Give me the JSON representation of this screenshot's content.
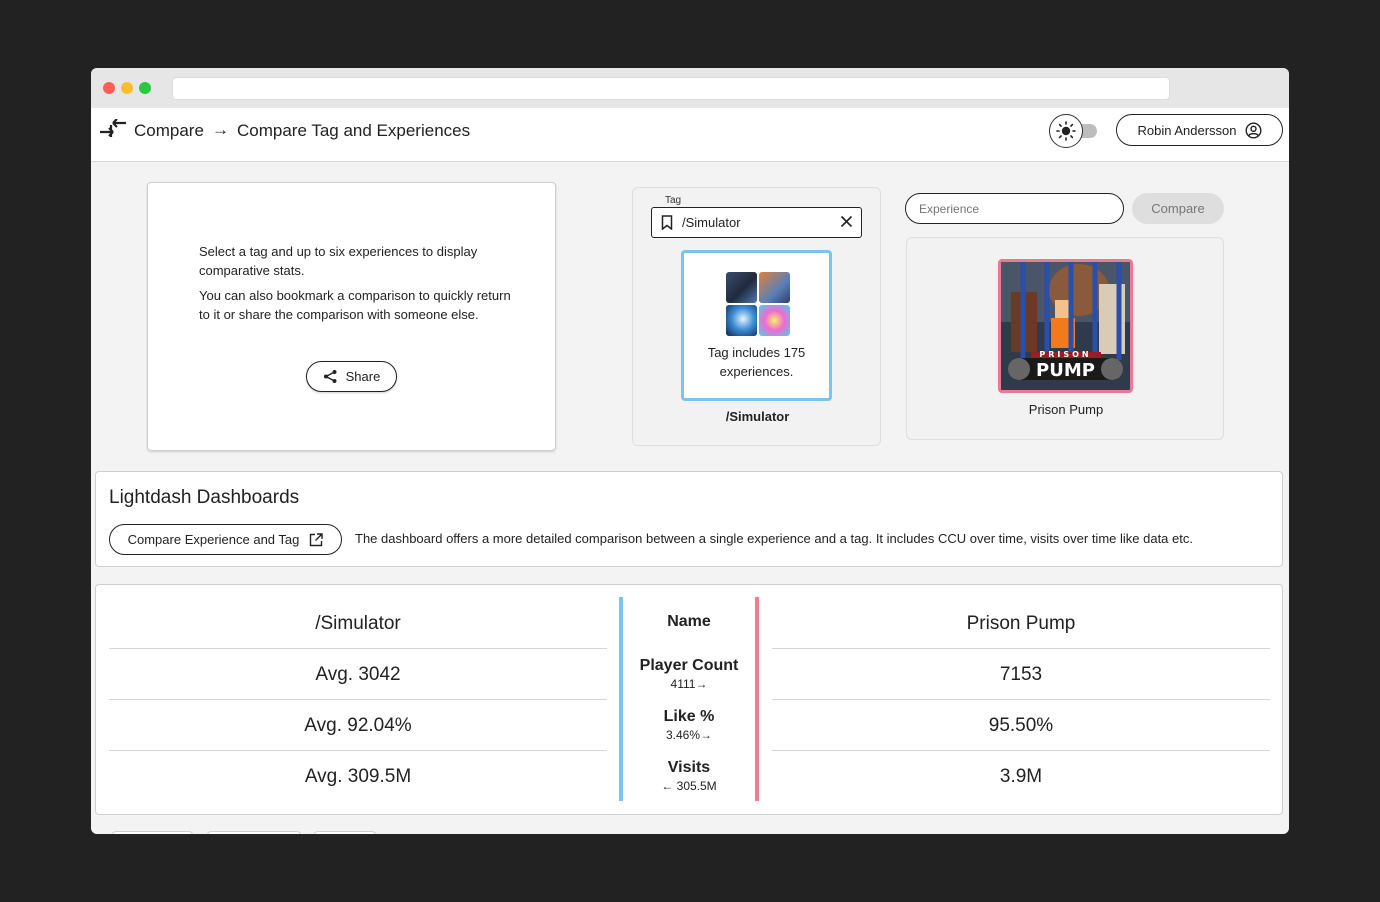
{
  "header": {
    "breadcrumb_root": "Compare",
    "breadcrumb_arrow": "→",
    "breadcrumb_current": "Compare Tag and Experiences",
    "user_name": "Robin Andersson",
    "theme_toggle": "light"
  },
  "info": {
    "paragraph1": "Select a tag and up to six experiences to display comparative stats.",
    "paragraph2": "You can also bookmark a comparison to quickly return to it or share the comparison with someone else.",
    "share_label": "Share"
  },
  "tag": {
    "label": "Tag",
    "value": "/Simulator",
    "tile_text": "Tag includes 175 experiences.",
    "name": "/Simulator"
  },
  "experience": {
    "placeholder": "Experience",
    "compare_label": "Compare",
    "name": "Prison Pump",
    "thumb_title_small": "PRISON",
    "thumb_title_big": "PUMP"
  },
  "dashboards": {
    "title": "Lightdash Dashboards",
    "button_label": "Compare Experience and Tag",
    "description": "The dashboard offers a more detailed comparison between a single experience and a tag. It includes CCU over time, visits over time like data etc."
  },
  "comparison": {
    "left_header": "/Simulator",
    "mid_header": "Name",
    "right_header": "Prison Pump",
    "rows": [
      {
        "metric": "Player Count",
        "left": "Avg. 3042",
        "right": "7153",
        "diff": "4111→"
      },
      {
        "metric": "Like %",
        "left": "Avg. 92.04%",
        "right": "95.50%",
        "diff": "3.46%→"
      },
      {
        "metric": "Visits",
        "left": "Avg. 309.5M",
        "right": "3.9M",
        "diff": "← 305.5M"
      }
    ]
  },
  "colors": {
    "tag_accent": "#7cc3ef",
    "experience_accent": "#ee7e93"
  }
}
